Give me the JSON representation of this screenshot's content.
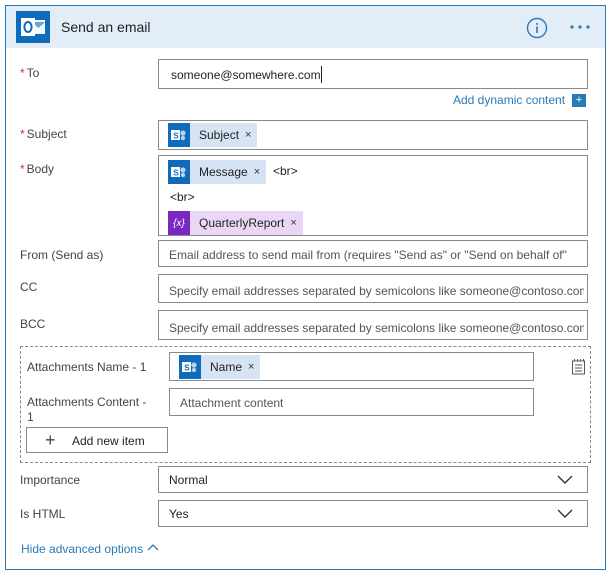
{
  "card": {
    "title": "Send an email",
    "accent": "#2a7ab8",
    "header_bg": "#e2edf8",
    "icons": {
      "app": "outlook-icon",
      "info": "info-icon",
      "menu": "more-options-icon"
    }
  },
  "fields": {
    "required_marker": "*",
    "to": {
      "label": "To",
      "value": "someone@somewhere.com"
    },
    "dynamic_content": {
      "label": "Add dynamic content",
      "icon": "+"
    },
    "subject": {
      "label": "Subject",
      "tokens": [
        {
          "label": "Subject",
          "remove": "×",
          "icon": "sharepoint-icon"
        }
      ]
    },
    "body": {
      "label": "Body",
      "tokens": [
        {
          "label": "Message",
          "remove": "×",
          "icon": "sharepoint-icon"
        },
        {
          "label": "QuarterlyReport",
          "remove": "×",
          "icon": "expression-icon",
          "icon_text": "{x}"
        }
      ],
      "text_after_message": "<br>",
      "line2": "<br>"
    },
    "from": {
      "label": "From (Send as)",
      "placeholder": "Email address to send mail from (requires \"Send as\" or \"Send on behalf of\""
    },
    "cc": {
      "label": "CC",
      "placeholder": "Specify email addresses separated by semicolons like someone@contoso.com"
    },
    "bcc": {
      "label": "BCC",
      "placeholder": "Specify email addresses separated by semicolons like someone@contoso.com"
    }
  },
  "attachments": {
    "name_label": "Attachments Name - 1",
    "name_token": {
      "label": "Name",
      "remove": "×",
      "icon": "sharepoint-icon"
    },
    "content_label_line1": "Attachments Content -",
    "content_label_line2": "1",
    "content_placeholder": "Attachment content",
    "add_item_icon": "+",
    "add_item_label": "Add new item",
    "side_icon": "array-mode-icon"
  },
  "importance": {
    "label": "Importance",
    "value": "Normal"
  },
  "is_html": {
    "label": "Is HTML",
    "value": "Yes"
  },
  "advanced": {
    "label": "Hide advanced options"
  }
}
